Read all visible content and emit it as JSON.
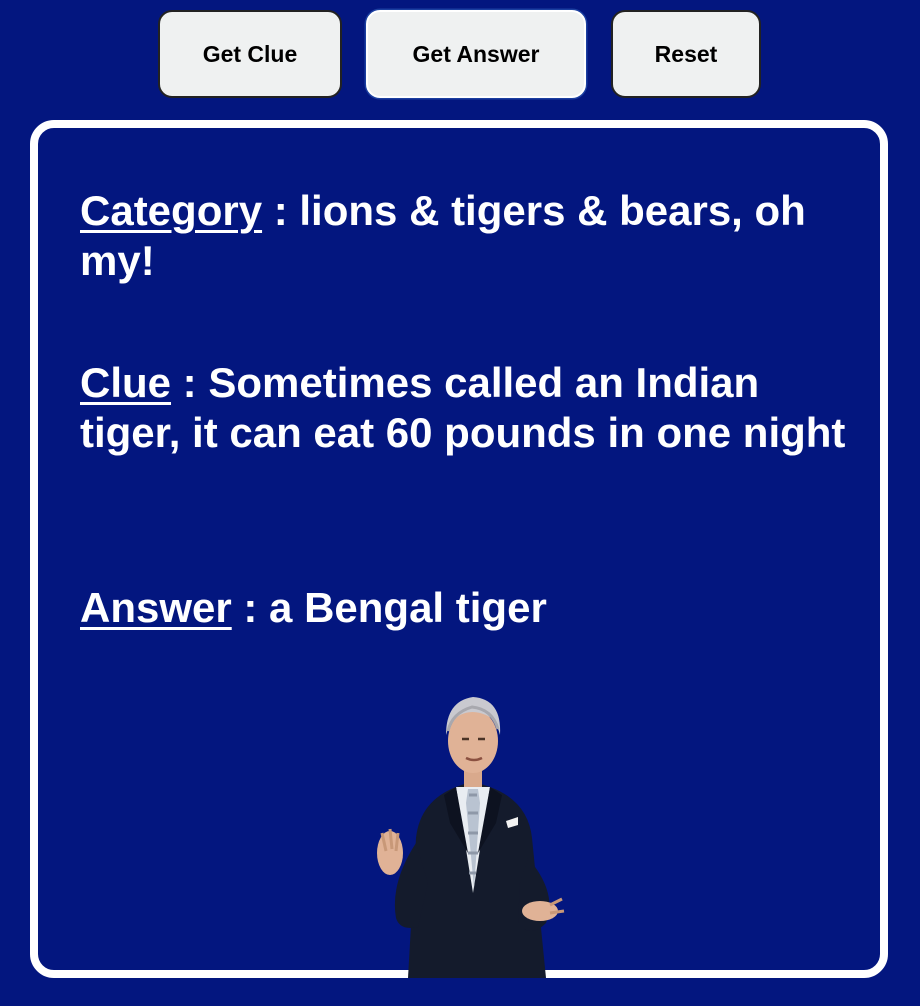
{
  "toolbar": {
    "get_clue_label": "Get Clue",
    "get_answer_label": "Get Answer",
    "reset_label": "Reset"
  },
  "card": {
    "category": {
      "label": "Category",
      "separator": " : ",
      "value": "lions & tigers & bears, oh my!"
    },
    "clue": {
      "label": "Clue",
      "separator": " : ",
      "value": "Sometimes called an Indian tiger, it can eat 60 pounds in one night"
    },
    "answer": {
      "label": "Answer",
      "separator": " : ",
      "value": "a Bengal tiger"
    }
  },
  "colors": {
    "background": "#03167f",
    "card_border": "#ffffff",
    "button_bg": "#eff1f1",
    "text": "#ffffff"
  },
  "host_image": {
    "icon": "host-photo"
  }
}
